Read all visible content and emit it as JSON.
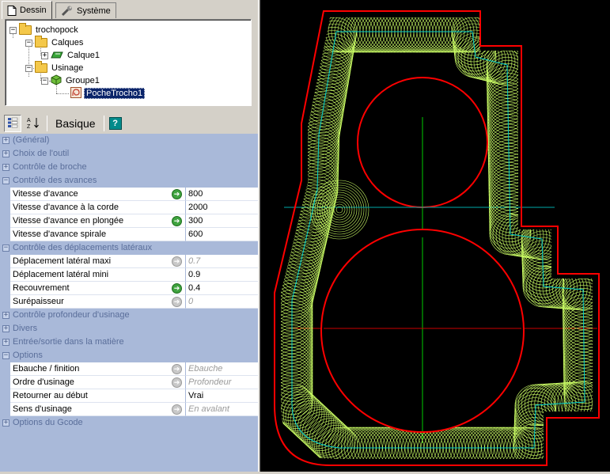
{
  "tabs": [
    {
      "label": "Dessin",
      "icon": "document-icon"
    },
    {
      "label": "Système",
      "icon": "wrench-icon"
    }
  ],
  "tree": {
    "root": "trochopock",
    "calques": "Calques",
    "calque1": "Calque1",
    "usinage": "Usinage",
    "groupe1": "Groupe1",
    "poche": "PocheTrocho1"
  },
  "toolbar": {
    "categorized_icon": "categorized-icon",
    "alpha_icon": "sort-az-icon",
    "basique_label": "Basique",
    "help_label": "?"
  },
  "grid": {
    "c_general": "(Général)",
    "c_outil": "Choix de l'outil",
    "c_broche": "Contrôle de broche",
    "c_avances": "Contrôle des avances",
    "p_vitesse_avance": {
      "name": "Vitesse d'avance",
      "value": "800"
    },
    "p_vitesse_corde": {
      "name": "Vitesse d'avance à la corde",
      "value": "2000"
    },
    "p_vitesse_plongee": {
      "name": "Vitesse d'avance en plongée",
      "value": "300"
    },
    "p_vitesse_spirale": {
      "name": "Vitesse d'avance spirale",
      "value": "600"
    },
    "c_deplacements": "Contrôle des déplacements latéraux",
    "p_depl_maxi": {
      "name": "Déplacement latéral maxi",
      "value": "0.7"
    },
    "p_depl_mini": {
      "name": "Déplacement latéral mini",
      "value": "0.9"
    },
    "p_recouvrement": {
      "name": "Recouvrement",
      "value": "0.4"
    },
    "p_surepaisseur": {
      "name": "Surépaisseur",
      "value": "0"
    },
    "c_profondeur": "Contrôle profondeur d'usinage",
    "c_divers": "Divers",
    "c_entree": "Entrée/sortie dans la matière",
    "c_options": "Options",
    "p_ebauche": {
      "name": "Ebauche / finition",
      "value": "Ebauche"
    },
    "p_ordre": {
      "name": "Ordre d'usinage",
      "value": "Profondeur d'abord"
    },
    "p_retourner": {
      "name": "Retourner au début",
      "value": "Vrai"
    },
    "p_sens": {
      "name": "Sens d'usinage",
      "value": "En avalant"
    },
    "c_gcode": "Options du Gcode"
  },
  "colors": {
    "contour": "#ff0000",
    "toolpath": "#ccff66",
    "cyan_path": "#00e0e0",
    "axis": "#00cc00",
    "selection": "#0a246a"
  }
}
